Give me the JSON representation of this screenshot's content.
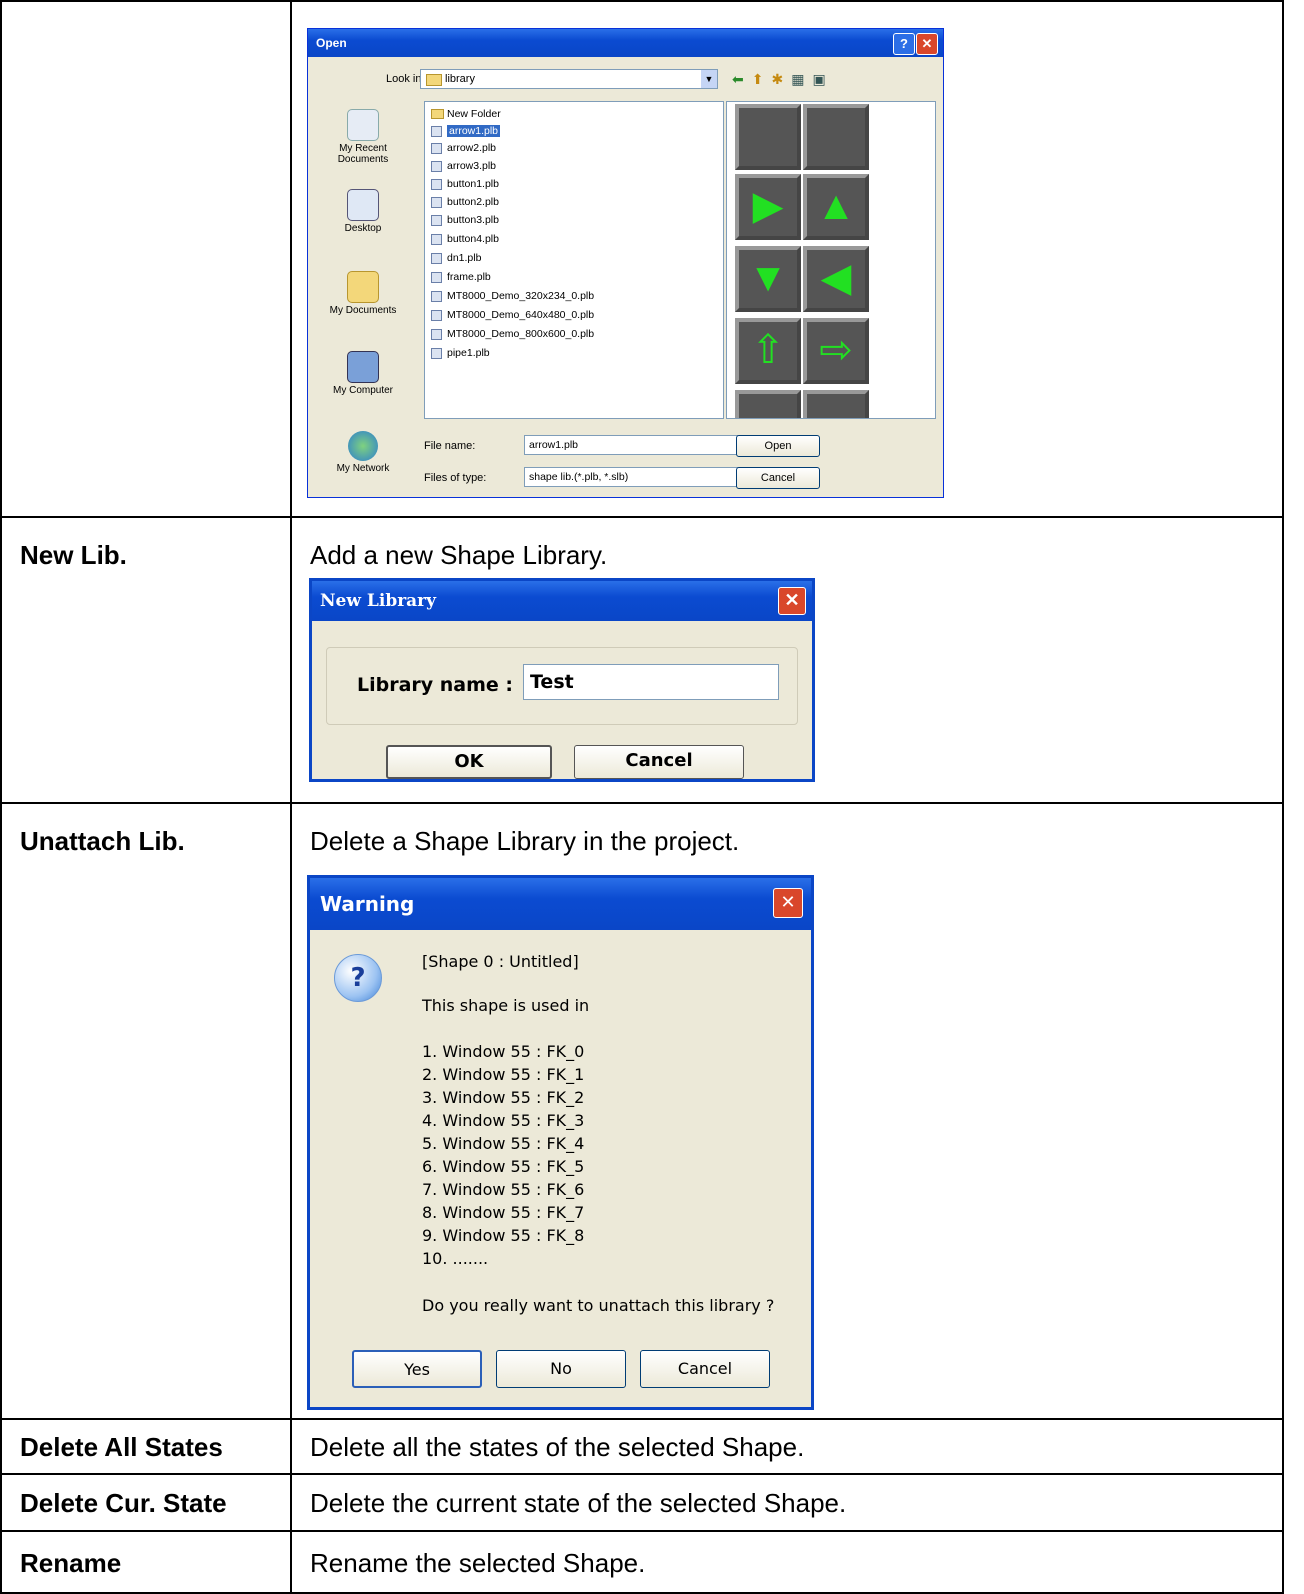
{
  "open_dialog": {
    "title": "Open",
    "help_glyph": "?",
    "close_glyph": "✕",
    "look_in_label": "Look in:",
    "look_in_value": "library",
    "places": [
      "My Recent Documents",
      "Desktop",
      "My Documents",
      "My Computer",
      "My Network"
    ],
    "files": [
      "New Folder",
      "arrow1.plb",
      "arrow2.plb",
      "arrow3.plb",
      "button1.plb",
      "button2.plb",
      "button3.plb",
      "button4.plb",
      "dn1.plb",
      "frame.plb",
      "MT8000_Demo_320x234_0.plb",
      "MT8000_Demo_640x480_0.plb",
      "MT8000_Demo_800x600_0.plb",
      "pipe1.plb"
    ],
    "selected_file": "arrow1.plb",
    "file_name_label": "File name:",
    "file_name_value": "arrow1.plb",
    "file_type_label": "Files of type:",
    "file_type_value": "shape lib.(*.plb, *.slb)",
    "open_button": "Open",
    "cancel_button": "Cancel",
    "preview_arrows": [
      "",
      "",
      "▶",
      "▲",
      "▼",
      "◀",
      "⇧",
      "⇨"
    ]
  },
  "rows": {
    "new_lib": {
      "term": "New Lib.",
      "desc": "Add a new Shape Library."
    },
    "unattach": {
      "term": "Unattach Lib.",
      "desc": "Delete a Shape Library in the project."
    },
    "delete_all": {
      "term": "Delete All States",
      "desc": "Delete all the states of the selected Shape."
    },
    "delete_cur": {
      "term": "Delete Cur. State",
      "desc": "Delete the current state of the selected Shape."
    },
    "rename": {
      "term": "Rename",
      "desc": "Rename the selected Shape."
    }
  },
  "new_library_dialog": {
    "title": "New Library",
    "close_glyph": "✕",
    "label": "Library name :",
    "value": "Test",
    "ok": "OK",
    "cancel": "Cancel"
  },
  "warning_dialog": {
    "title": "Warning",
    "close_glyph": "✕",
    "icon_glyph": "?",
    "header": "[Shape 0 : Untitled]",
    "used_in": "This shape is used in",
    "items": [
      "1. Window 55 : FK_0",
      "2. Window 55 : FK_1",
      "3. Window 55 : FK_2",
      "4. Window 55 : FK_3",
      "5. Window 55 : FK_4",
      "6. Window 55 : FK_5",
      "7. Window 55 : FK_6",
      "8. Window 55 : FK_7",
      "9. Window 55 : FK_8",
      "10. ......."
    ],
    "question": "Do you really want to unattach this library ?",
    "yes": "Yes",
    "no": "No",
    "cancel": "Cancel"
  },
  "colors": {
    "titlebar": "#0b4bd1",
    "dialog_bg": "#ece9d8",
    "selection": "#316ac5",
    "arrow_green": "#22e022"
  }
}
